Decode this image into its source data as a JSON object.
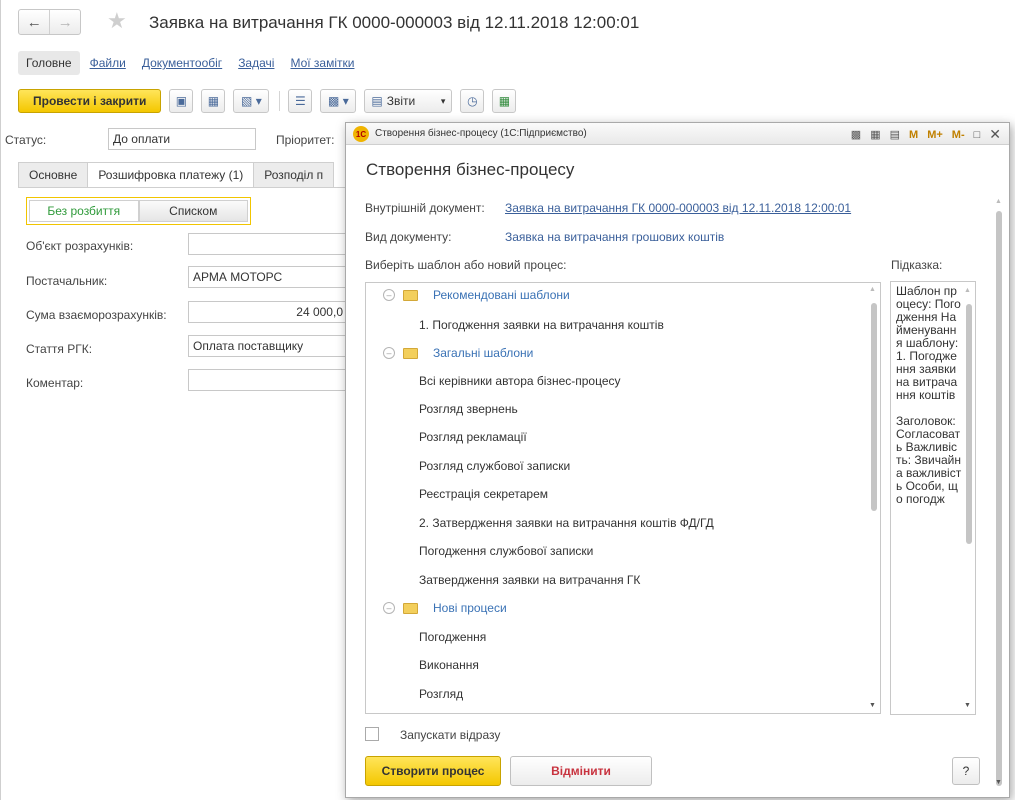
{
  "main": {
    "title": "Заявка на витрачання ГК 0000-000003 від 12.11.2018 12:00:01",
    "tabs": [
      "Головне",
      "Файли",
      "Документообіг",
      "Задачі",
      "Мої замітки"
    ],
    "toolbar": {
      "post_close": "Провести і закрити",
      "reports": "Звіти"
    },
    "status_label": "Статус:",
    "status_value": "До оплати",
    "priority_label": "Пріоритет:",
    "sub_tabs": [
      "Основне",
      "Розшифровка платежу (1)",
      "Розподіл п"
    ],
    "toggle": {
      "without_split": "Без розбиття",
      "as_list": "Списком"
    },
    "fields": {
      "object_label": "Об'єкт розрахунків:",
      "supplier_label": "Постачальник:",
      "supplier_value": "АРМА МОТОРС",
      "sum_label": "Сума взаєморозрахунків:",
      "sum_value": "24 000,0",
      "article_label": "Стаття РГК:",
      "article_value": "Оплата поставщику",
      "comment_label": "Коментар:"
    }
  },
  "dialog": {
    "window_title": "Створення бізнес-процесу (1С:Підприємство)",
    "window_controls": {
      "m": "M",
      "m_plus": "M+",
      "m_minus": "M-"
    },
    "logo": "1С",
    "heading": "Створення бізнес-процесу",
    "internal_doc_label": "Внутрішній документ:",
    "internal_doc_value": "Заявка на витрачання ГК 0000-000003 від 12.11.2018 12:00:01",
    "doc_type_label": "Вид документу:",
    "doc_type_value": "Заявка на витрачання грошових коштів",
    "choose_label": "Виберіть шаблон або новий процес:",
    "hint_label": "Підказка:",
    "groups": [
      {
        "name": "Рекомендовані шаблони",
        "items": [
          "1. Погодження заявки на витрачання коштів"
        ]
      },
      {
        "name": "Загальні шаблони",
        "items": [
          "Всі керівники автора бізнес-процесу",
          "Розгляд звернень",
          "Розгляд рекламації",
          "Розгляд службової записки",
          "Реєстрація секретарем",
          "2. Затвердження заявки на витрачання коштів ФД/ГД",
          "Погодження службової записки",
          "Затвердження заявки на витрачання ГК"
        ]
      },
      {
        "name": "Нові процеси",
        "items": [
          "Погодження",
          "Виконання",
          "Розгляд"
        ]
      }
    ],
    "hint_text": "Шаблон процесу: Погодження Найменування шаблону: 1. Погодження заявки на витрачання коштів\n\nЗаголовок: Согласовать Важливість: Звичайна важливість Особи, що погодж",
    "run_immediately": "Запускати відразу",
    "create_button": "Створити процес",
    "cancel_button": "Відмінити",
    "help_button": "?"
  }
}
